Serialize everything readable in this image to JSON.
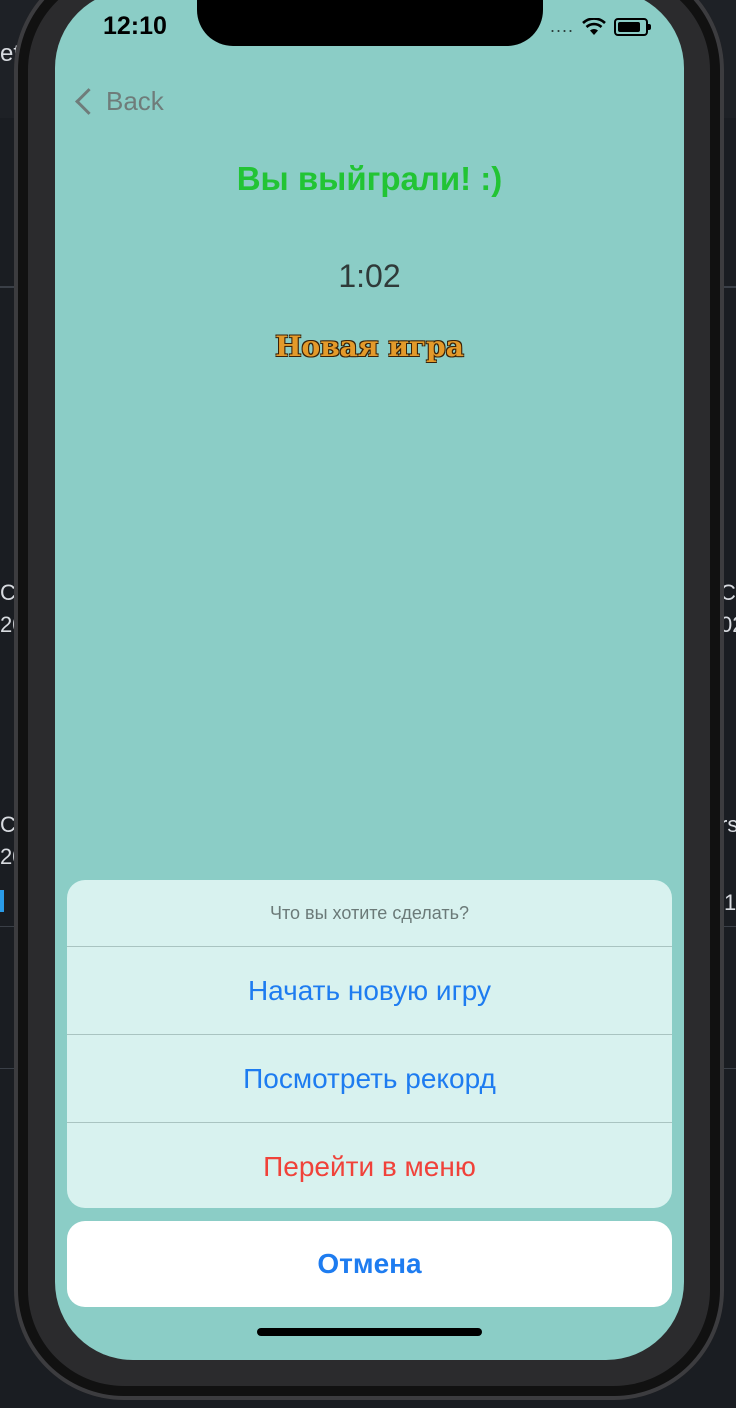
{
  "status_bar": {
    "time": "12:10",
    "signal": "....",
    "wifi_icon": "wifi-icon",
    "battery_icon": "battery-icon"
  },
  "nav": {
    "back_label": "Back"
  },
  "game": {
    "result_title": "Вы выйграли! :)",
    "timer": "1:02",
    "new_game_label": "Новая игра"
  },
  "action_sheet": {
    "title": "Что вы хотите сделать?",
    "options": [
      {
        "label": "Начать новую игру",
        "style": "default"
      },
      {
        "label": "Посмотреть рекорд",
        "style": "default"
      },
      {
        "label": "Перейти в меню",
        "style": "destructive"
      }
    ],
    "cancel_label": "Отмена"
  },
  "background_fragments": {
    "left_top": "et",
    "left_a": "C",
    "left_b": "20",
    "left_c": "C",
    "left_d": "20",
    "right_a": "C",
    "right_b": "02",
    "right_c": "rs",
    "right_d": "1"
  },
  "colors": {
    "screen_bg": "#8bcdc6",
    "title_green": "#22c434",
    "ios_blue": "#1e7cf0",
    "destructive_red": "#f0423a",
    "new_game_orange": "#e49a2a"
  }
}
